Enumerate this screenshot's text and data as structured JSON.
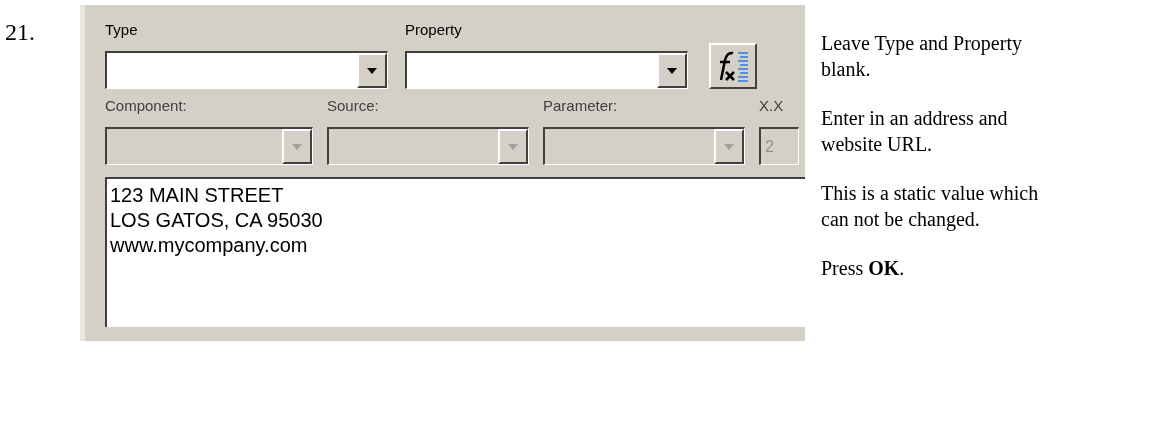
{
  "step_number": "21.",
  "dialog": {
    "top_fields": [
      {
        "label": "Type",
        "kind": "dropdown",
        "disabled": false
      },
      {
        "label": "Property",
        "kind": "dropdown",
        "disabled": false
      }
    ],
    "detail_fields": [
      {
        "label": "Component:",
        "kind": "dropdown",
        "disabled": true
      },
      {
        "label": "Source:",
        "kind": "dropdown",
        "disabled": true
      },
      {
        "label": "Parameter:",
        "kind": "dropdown",
        "disabled": true
      },
      {
        "label": "X.X",
        "kind": "text",
        "value": "2",
        "disabled": true
      }
    ],
    "text_area_lines": [
      "123 MAIN STREET",
      "LOS GATOS, CA 95030",
      "www.mycompany.com"
    ]
  },
  "instructions": [
    "Leave Type and Property blank.",
    "Enter in an address and website URL.",
    "This is a static value which can not be changed.",
    "Press **OK**."
  ]
}
